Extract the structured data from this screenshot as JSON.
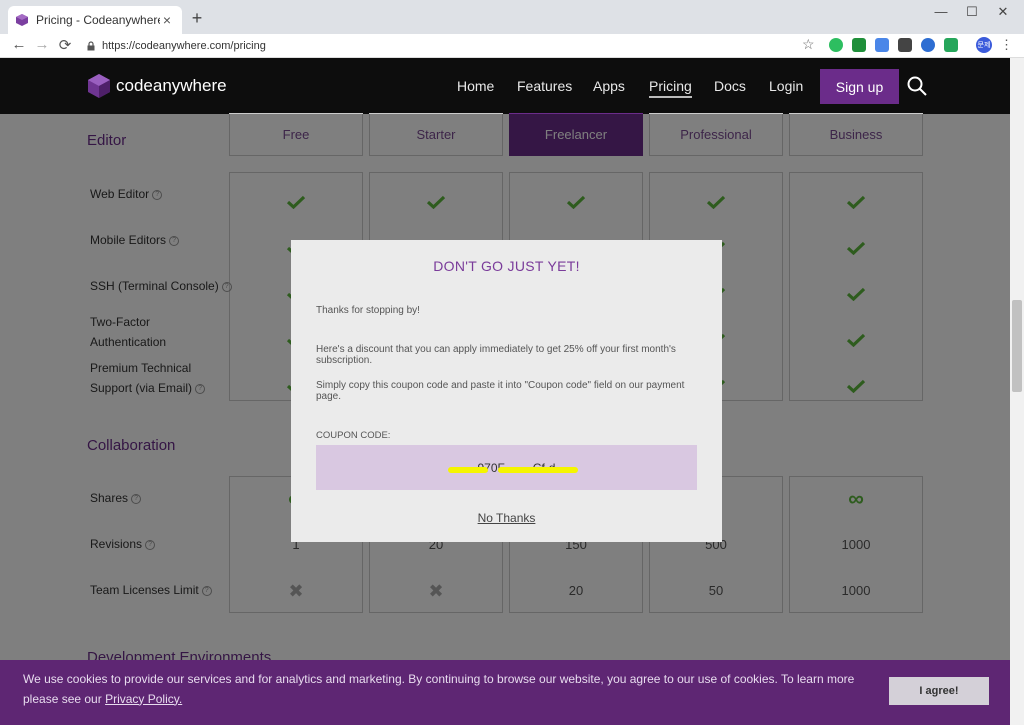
{
  "browser": {
    "tab_title": "Pricing - Codeanywhere",
    "tab_close": "×",
    "new_tab": "+",
    "url": "https://codeanywhere.com/pricing",
    "win_min": "—",
    "win_max": "☐",
    "win_close": "✕",
    "back": "←",
    "forward": "→",
    "reload": "⟳",
    "star": "☆",
    "profile_label": "문제",
    "menu": "⋮"
  },
  "site": {
    "logo_text": "codeanywhere",
    "nav": {
      "home": "Home",
      "features": "Features",
      "apps": "Apps",
      "pricing": "Pricing",
      "docs": "Docs",
      "login": "Login",
      "signup": "Sign up"
    }
  },
  "pricing": {
    "editor_title": "Editor",
    "plans": [
      "Free",
      "Starter",
      "Freelancer",
      "Professional",
      "Business"
    ],
    "editor_rows": [
      {
        "label": "Web Editor"
      },
      {
        "label": "Mobile Editors"
      },
      {
        "label": "SSH (Terminal Console)"
      },
      {
        "label_line1": "Two-Factor",
        "label_line2": "Authentication"
      },
      {
        "label_line1": "Premium Technical",
        "label_line2": "Support (via Email)"
      }
    ],
    "collab_title": "Collaboration",
    "collab_rows": [
      {
        "label": "Shares"
      },
      {
        "label": "Revisions",
        "values": [
          "1",
          "20",
          "150",
          "500",
          "1000"
        ]
      },
      {
        "label": "Team Licenses Limit",
        "values": [
          "20",
          "50",
          "1000"
        ]
      }
    ],
    "dev_title": "Development Environments",
    "question_mark": "?",
    "infinity": "∞",
    "cross": "✖"
  },
  "modal": {
    "title": "DON'T GO JUST YET!",
    "line1": "Thanks for stopping by!",
    "line2": "Here's a discount that you can apply immediately to get 25% off your first month's subscription.",
    "line3": "Simply copy this coupon code and paste it into \"Coupon code\" field on our payment page.",
    "coupon_label": "COUPON CODE:",
    "coupon_code": "·····970F·······Cf·d",
    "no_thanks": "No Thanks"
  },
  "cookie": {
    "text": "We use cookies to provide our services and for analytics and marketing. By continuing to browse our website, you agree to our use of cookies. To learn more please see our",
    "link": "Privacy Policy.",
    "agree": "I agree!"
  },
  "colors": {
    "brand_purple": "#6b2c8a",
    "check_green": "#5cb83c",
    "coupon_bg": "#d9c8e1"
  }
}
